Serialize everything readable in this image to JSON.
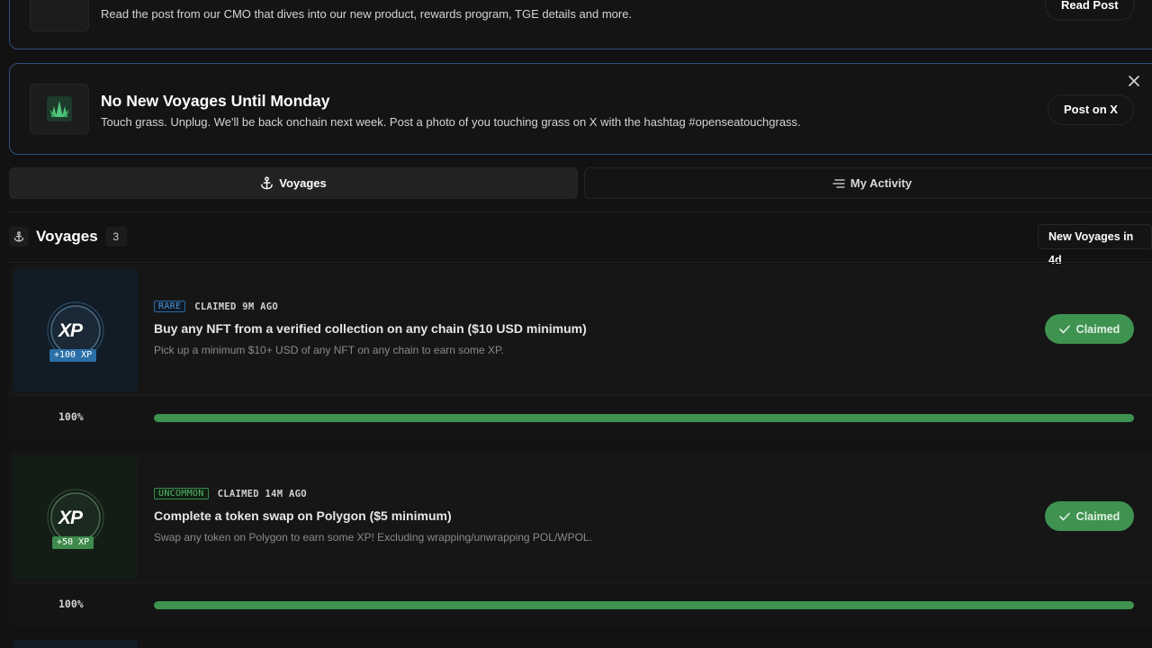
{
  "banners": {
    "top": {
      "description": "Read the post from our CMO that dives into our new product, rewards program, TGE details and more.",
      "button_label": "Read Post"
    },
    "mid": {
      "title": "No New Voyages Until Monday",
      "description": "Touch grass. Unplug. We'll be back onchain next week. Post a photo of you touching grass on X with the hashtag #openseatouchgrass.",
      "button_label": "Post on X"
    }
  },
  "tabs": [
    {
      "label": "Voyages",
      "icon": "anchor-icon",
      "active": true
    },
    {
      "label": "My Activity",
      "icon": "list-icon",
      "active": false
    }
  ],
  "section": {
    "title": "Voyages",
    "count": "3",
    "new_voyages_label": "New Voyages in 4d"
  },
  "voyages": [
    {
      "rarity": "RARE",
      "claimed": "CLAIMED 9M AGO",
      "title": "Buy any NFT from a verified collection on any chain ($10 USD minimum)",
      "description": "Pick up a minimum $10+ USD of any NFT on any chain to earn some XP.",
      "xp_label": "XP",
      "xp_reward": "+100 XP",
      "button_label": "Claimed",
      "progress_text": "100%",
      "progress": 1.0
    },
    {
      "rarity": "UNCOMMON",
      "claimed": "CLAIMED 14M AGO",
      "title": "Complete a token swap on Polygon ($5 minimum)",
      "description": "Swap any token on Polygon to earn some XP! Excluding wrapping/unwrapping POL/WPOL.",
      "xp_label": "XP",
      "xp_reward": "+50 XP",
      "button_label": "Claimed",
      "progress_text": "100%",
      "progress": 1.0
    }
  ],
  "colors": {
    "background": "#121212",
    "banner_border": "#2d4f80",
    "rare": "#4a94d8",
    "uncommon": "#56b268",
    "claimed_green": "#3f9350"
  }
}
